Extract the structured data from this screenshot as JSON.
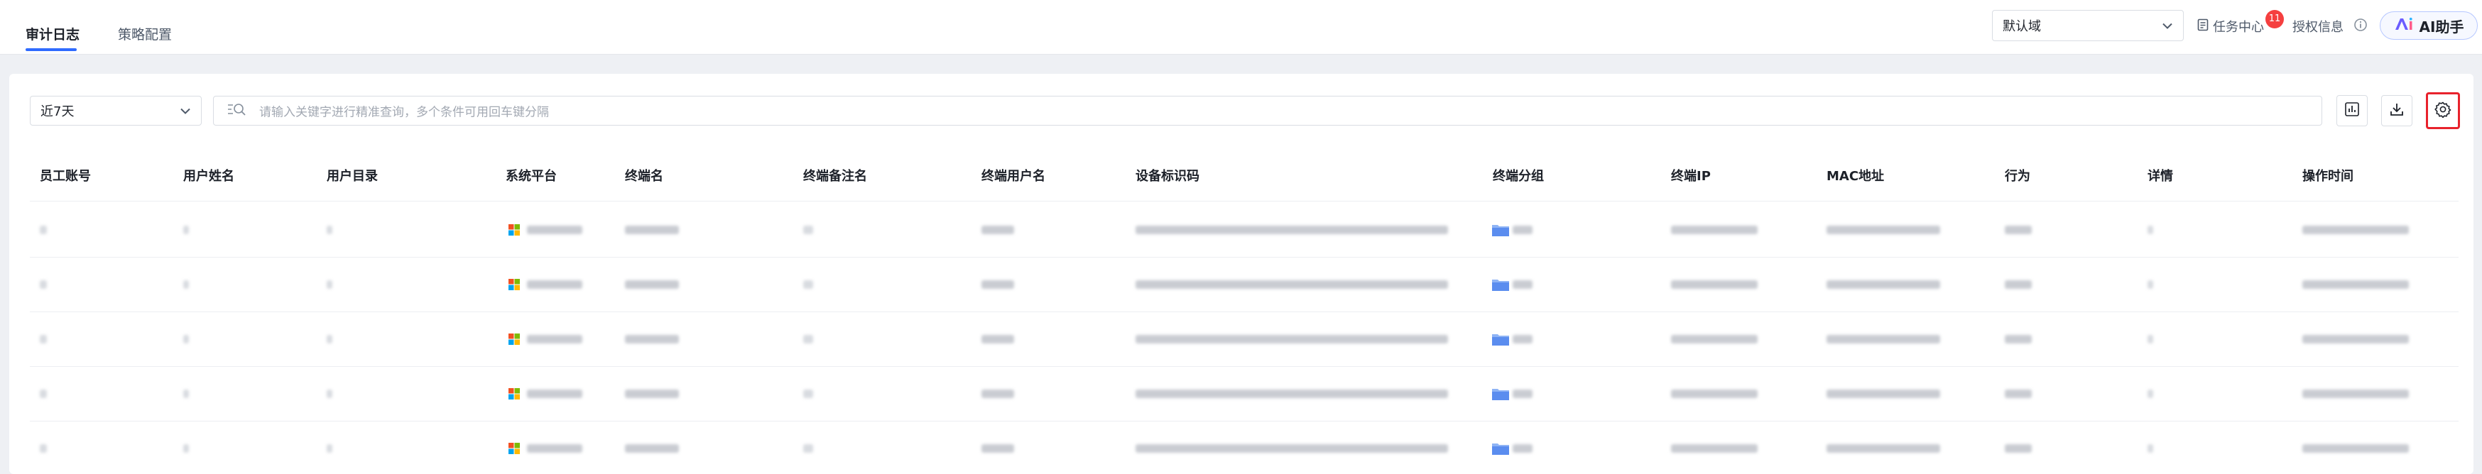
{
  "tabs": [
    {
      "label": "审计日志",
      "active": true
    },
    {
      "label": "策略配置",
      "active": false
    }
  ],
  "header": {
    "domain_select": "默认域",
    "task_center": "任务中心",
    "task_badge": "11",
    "license_info": "授权信息",
    "ai_button": "AI助手"
  },
  "toolbar": {
    "date_range": "近7天",
    "search_placeholder": "请输入关键字进行精准查询，多个条件可用回车键分隔"
  },
  "table": {
    "columns": [
      "员工账号",
      "用户姓名",
      "用户目录",
      "系统平台",
      "终端名",
      "终端备注名",
      "终端用户名",
      "设备标识码",
      "终端分组",
      "终端IP",
      "MAC地址",
      "行为",
      "详情",
      "操作时间"
    ],
    "row_count": 5
  },
  "colors": {
    "accent": "#2f6bff",
    "highlight": "#e8222c",
    "badge": "#f53f3f"
  },
  "icons": [
    "chevron-down-icon",
    "document-icon",
    "info-icon",
    "ai-logo-icon",
    "search-filter-icon",
    "chart-icon",
    "download-icon",
    "settings-icon",
    "windows-icon",
    "folder-icon"
  ]
}
